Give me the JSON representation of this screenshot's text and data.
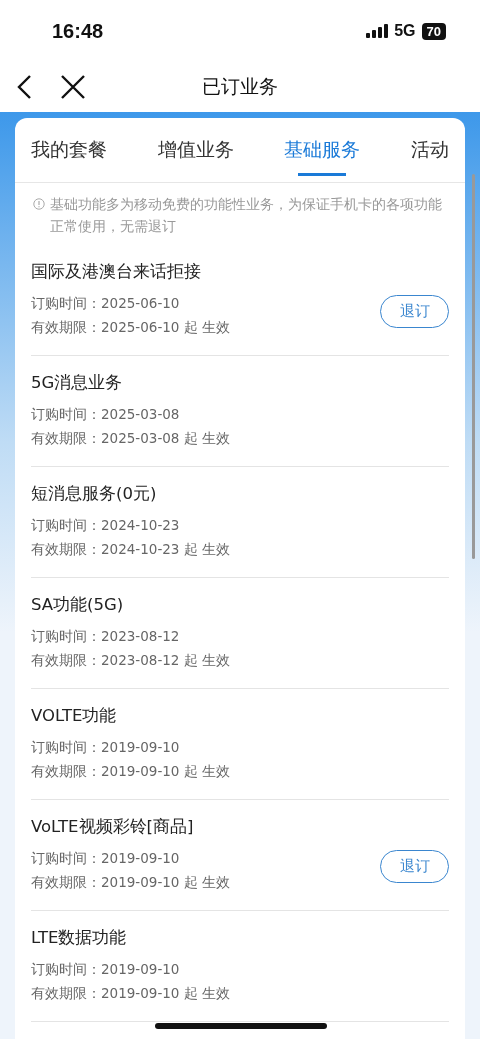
{
  "status_bar": {
    "time": "16:48",
    "network": "5G",
    "battery": "70"
  },
  "nav": {
    "title": "已订业务"
  },
  "tabs": [
    {
      "label": "我的套餐",
      "selected": false
    },
    {
      "label": "增值业务",
      "selected": false
    },
    {
      "label": "基础服务",
      "selected": true
    },
    {
      "label": "活动",
      "selected": false
    }
  ],
  "notice": "基础功能多为移动免费的功能性业务，为保证手机卡的各项功能正常使用，无需退订",
  "services": [
    {
      "name": "国际及港澳台来话拒接",
      "ordered": "订购时间：2025-06-10",
      "valid": "有效期限：2025-06-10 起 生效",
      "action": "退订"
    },
    {
      "name": "5G消息业务",
      "ordered": "订购时间：2025-03-08",
      "valid": "有效期限：2025-03-08 起 生效"
    },
    {
      "name": "短消息服务(0元)",
      "ordered": "订购时间：2024-10-23",
      "valid": "有效期限：2024-10-23 起 生效"
    },
    {
      "name": "SA功能(5G)",
      "ordered": "订购时间：2023-08-12",
      "valid": "有效期限：2023-08-12 起 生效"
    },
    {
      "name": "VOLTE功能",
      "ordered": "订购时间：2019-09-10",
      "valid": "有效期限：2019-09-10 起 生效"
    },
    {
      "name": "VoLTE视频彩铃[商品]",
      "ordered": "订购时间：2019-09-10",
      "valid": "有效期限：2019-09-10 起 生效",
      "action": "退订"
    },
    {
      "name": "LTE数据功能",
      "ordered": "订购时间：2019-09-10",
      "valid": "有效期限：2019-09-10 起 生效"
    }
  ]
}
